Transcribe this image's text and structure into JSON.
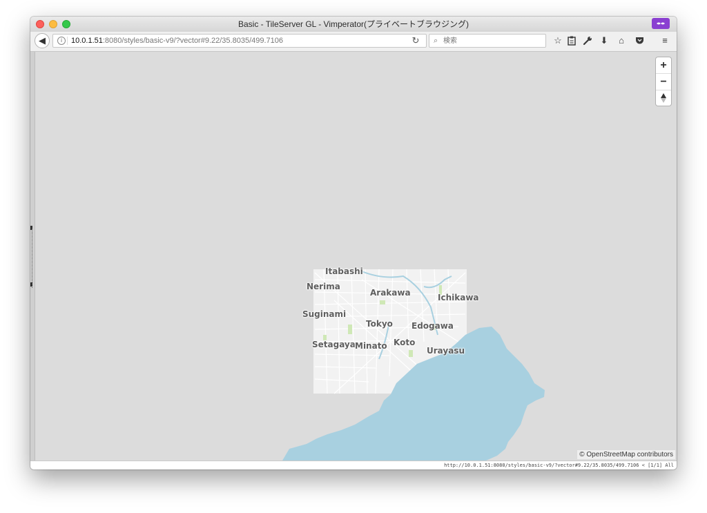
{
  "window": {
    "title": "Basic - TileServer GL - Vimperator(プライベートブラウジング)"
  },
  "navbar": {
    "url_host": "10.0.1.51",
    "url_rest": ":8080/styles/basic-v9/?vector#9.22/35.8035/499.7106",
    "search_placeholder": "検索"
  },
  "icons": {
    "back": "back-arrow-icon",
    "info": "info-icon",
    "reload": "reload-icon",
    "search": "search-icon",
    "bookmark": "star-icon",
    "reading_list": "clipboard-icon",
    "tools": "wrench-icon",
    "downloads": "download-icon",
    "home": "home-icon",
    "pocket": "pocket-icon",
    "menu": "hamburger-menu-icon"
  },
  "map": {
    "labels": [
      "Itabashi",
      "Nerima",
      "Arakawa",
      "Ichikawa",
      "Suginami",
      "Tokyo",
      "Edogawa",
      "Setagaya",
      "Minato",
      "Koto",
      "Urayasu"
    ],
    "attribution": "© OpenStreetMap contributors",
    "colors": {
      "background": "#dcdcdc",
      "water": "#a8d0e0",
      "land": "#f2f2f2",
      "roads": "#ffffff",
      "park": "#cfe8b6"
    }
  },
  "status": {
    "text": "http://10.0.1.51:8080/styles/basic-v9/?vector#9.22/35.8035/499.7106 < [1/1] All"
  }
}
